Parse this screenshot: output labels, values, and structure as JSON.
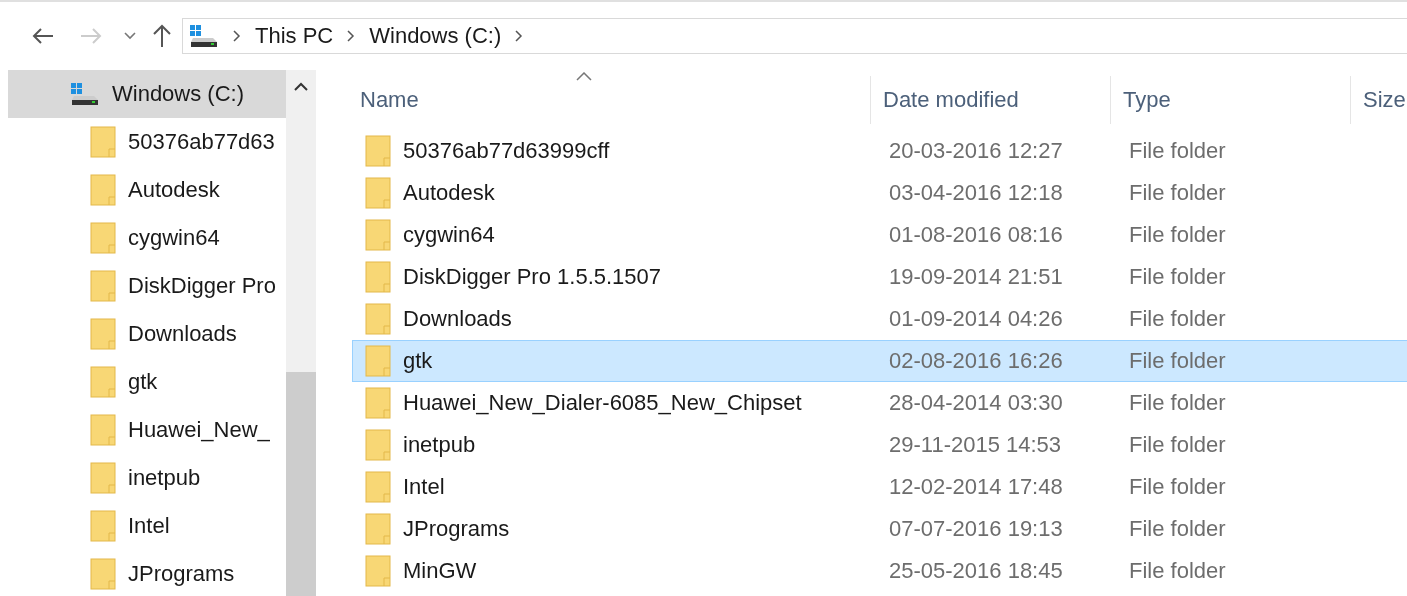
{
  "address_bar": {
    "crumbs": [
      "This PC",
      "Windows (C:)"
    ]
  },
  "sidebar": {
    "drive": {
      "label": "Windows (C:)",
      "selected": true
    },
    "items": [
      {
        "label": "50376ab77d63",
        "selected": false
      },
      {
        "label": "Autodesk",
        "selected": false
      },
      {
        "label": "cygwin64",
        "selected": false
      },
      {
        "label": "DiskDigger Pro",
        "selected": false
      },
      {
        "label": "Downloads",
        "selected": false
      },
      {
        "label": "gtk",
        "selected": false
      },
      {
        "label": "Huawei_New_",
        "selected": false
      },
      {
        "label": "inetpub",
        "selected": false
      },
      {
        "label": "Intel",
        "selected": false
      },
      {
        "label": "JPrograms",
        "selected": false
      }
    ]
  },
  "table": {
    "columns": [
      "Name",
      "Date modified",
      "Type",
      "Size"
    ],
    "rows": [
      {
        "name": "50376ab77d63999cff",
        "date": "20-03-2016 12:27",
        "type": "File folder",
        "selected": false
      },
      {
        "name": "Autodesk",
        "date": "03-04-2016 12:18",
        "type": "File folder",
        "selected": false
      },
      {
        "name": "cygwin64",
        "date": "01-08-2016 08:16",
        "type": "File folder",
        "selected": false
      },
      {
        "name": "DiskDigger Pro 1.5.5.1507",
        "date": "19-09-2014 21:51",
        "type": "File folder",
        "selected": false
      },
      {
        "name": "Downloads",
        "date": "01-09-2014 04:26",
        "type": "File folder",
        "selected": false
      },
      {
        "name": "gtk",
        "date": "02-08-2016 16:26",
        "type": "File folder",
        "selected": true
      },
      {
        "name": "Huawei_New_Dialer-6085_New_Chipset",
        "date": "28-04-2014 03:30",
        "type": "File folder",
        "selected": false
      },
      {
        "name": "inetpub",
        "date": "29-11-2015 14:53",
        "type": "File folder",
        "selected": false
      },
      {
        "name": "Intel",
        "date": "12-02-2014 17:48",
        "type": "File folder",
        "selected": false
      },
      {
        "name": "JPrograms",
        "date": "07-07-2016 19:13",
        "type": "File folder",
        "selected": false
      },
      {
        "name": "MinGW",
        "date": "25-05-2016 18:45",
        "type": "File folder",
        "selected": false
      }
    ]
  }
}
